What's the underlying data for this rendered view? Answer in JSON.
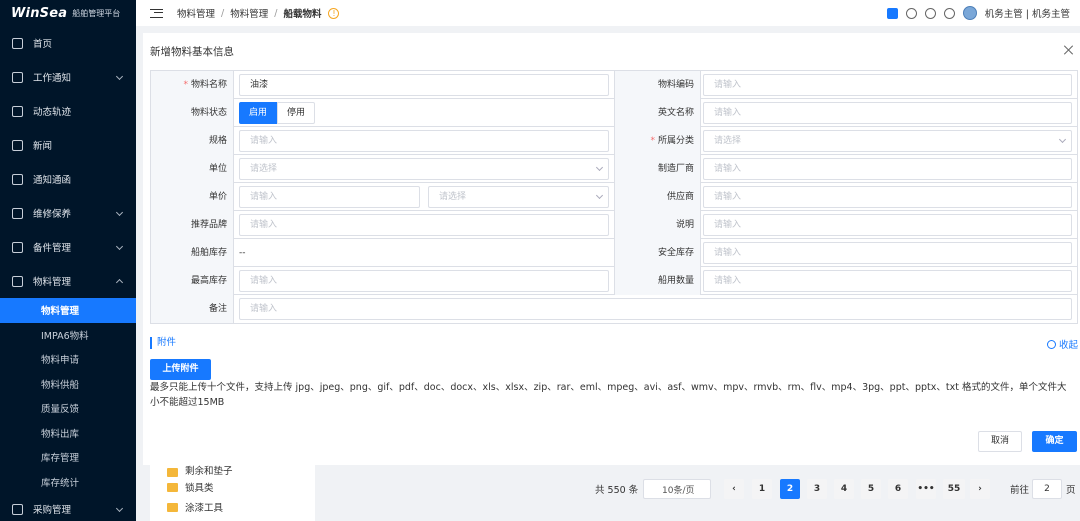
{
  "app": {
    "logo": "WinSea",
    "subtitle": "船舶管理平台"
  },
  "sidebar": {
    "items": [
      {
        "label": "首页",
        "icon": "home-icon"
      },
      {
        "label": "工作通知",
        "icon": "message-icon",
        "expandable": true
      },
      {
        "label": "动态轨迹",
        "icon": "track-icon"
      },
      {
        "label": "新闻",
        "icon": "news-icon"
      },
      {
        "label": "通知通函",
        "icon": "notice-icon"
      },
      {
        "label": "维修保养",
        "icon": "repair-icon",
        "expandable": true
      },
      {
        "label": "备件管理",
        "icon": "briefcase-icon",
        "expandable": true
      },
      {
        "label": "物料管理",
        "icon": "layers-icon",
        "expandable": true,
        "expanded": true
      }
    ],
    "subitems": [
      "物料管理",
      "IMPA6物料",
      "物料申请",
      "物料供船",
      "质量反馈",
      "物料出库",
      "库存管理",
      "库存统计"
    ],
    "active_sub": "物料管理",
    "bottom_item": {
      "label": "采购管理",
      "icon": "cart-icon"
    }
  },
  "topbar": {
    "breadcrumb": [
      "物料管理",
      "物料管理",
      "船载物料"
    ],
    "user": "机务主管 | 机务主管"
  },
  "background": {
    "tree": [
      "剩余和垫子",
      "锁具类",
      "涂漆工具"
    ],
    "pager": {
      "total": "共 550 条",
      "page_size": "10条/页",
      "pages": [
        "1",
        "2",
        "3",
        "4",
        "5",
        "6",
        "•••",
        "55"
      ],
      "current": "2",
      "goto_label": "前往",
      "goto_value": "2",
      "page_suffix": "页"
    }
  },
  "modal": {
    "title": "新增物料基本信息",
    "form": {
      "name_label": "物料名称",
      "name_value": "油漆",
      "code_label": "物料编码",
      "placeholder": "请输入",
      "select_placeholder": "请选择",
      "status_label": "物料状态",
      "status_on": "启用",
      "status_off": "停用",
      "en_name_label": "英文名称",
      "spec_label": "规格",
      "category_label": "所属分类",
      "unit_label": "单位",
      "manufacturer_label": "制造厂商",
      "price_label": "单价",
      "supplier_label": "供应商",
      "brand_label": "推荐品牌",
      "desc_label": "说明",
      "ship_stock_label": "船舶库存",
      "ship_stock_value": "--",
      "safety_stock_label": "安全库存",
      "max_stock_label": "最高库存",
      "ship_qty_label": "船用数量",
      "remark_label": "备注"
    },
    "attachment": {
      "label": "附件",
      "collapse": "收起",
      "upload": "上传附件",
      "hint": "最多只能上传十个文件，支持上传 jpg、jpeg、png、gif、pdf、doc、docx、xls、xlsx、zip、rar、eml、mpeg、avi、asf、wmv、mpv、rmvb、rm、flv、mp4、3pg、ppt、pptx、txt 格式的文件，单个文件大小不能超过15MB"
    },
    "buttons": {
      "cancel": "取消",
      "ok": "确定"
    }
  }
}
